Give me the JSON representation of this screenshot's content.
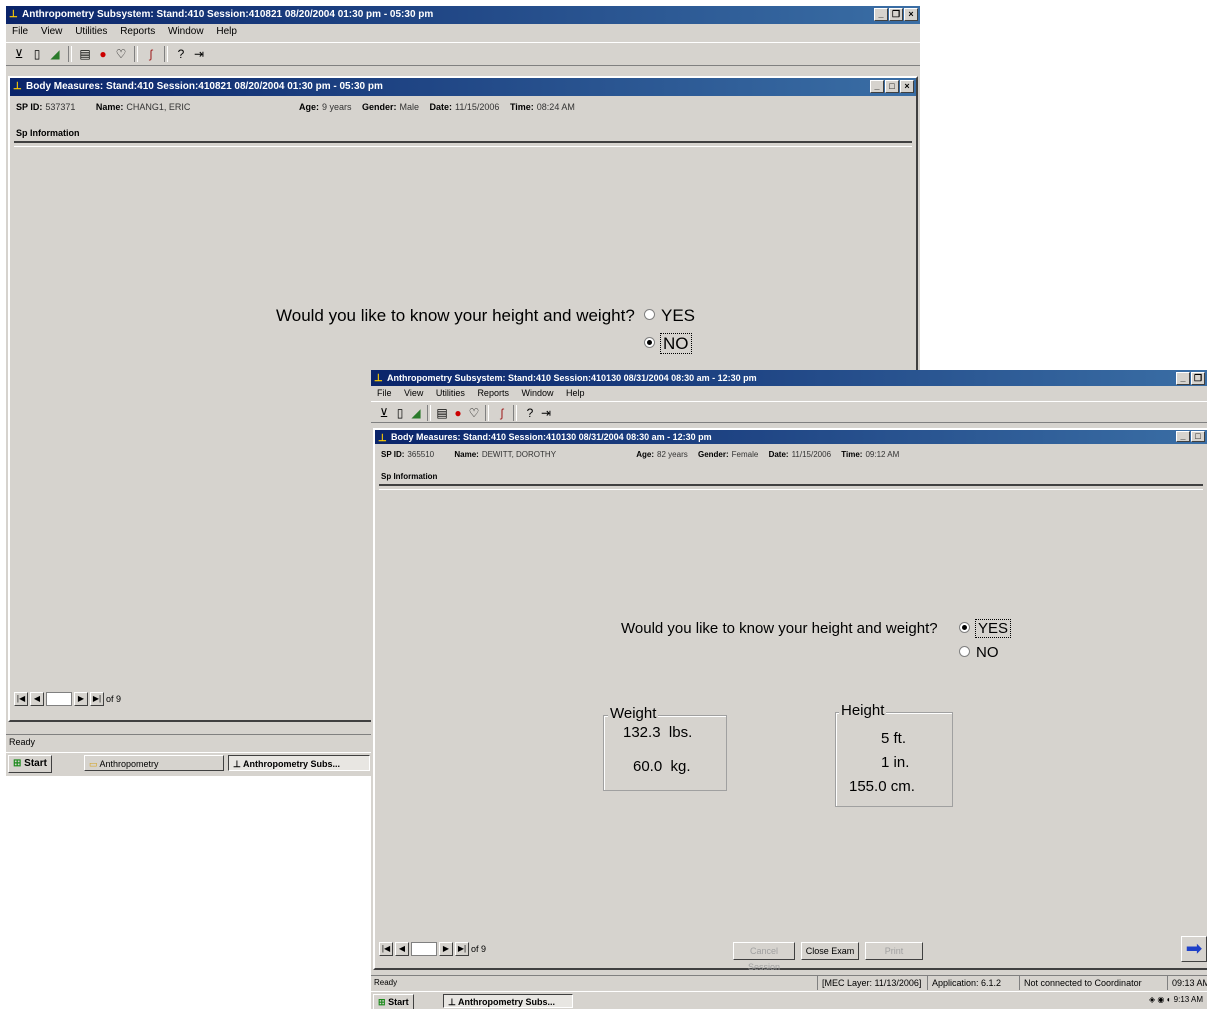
{
  "back": {
    "app_title": "Anthropometry Subsystem: Stand:410 Session:410821 08/20/2004 01:30 pm - 05:30 pm",
    "menu": [
      "File",
      "View",
      "Utilities",
      "Reports",
      "Window",
      "Help"
    ],
    "child_title": "Body Measures: Stand:410 Session:410821 08/20/2004 01:30 pm - 05:30 pm",
    "info": {
      "spid_label": "SP ID:",
      "spid": "537371",
      "name_label": "Name:",
      "name": "CHANG1, ERIC",
      "age_label": "Age:",
      "age": "9 years",
      "gender_label": "Gender:",
      "gender": "Male",
      "date_label": "Date:",
      "date": "11/15/2006",
      "time_label": "Time:",
      "time": "08:24 AM"
    },
    "section": "Sp Information",
    "question": "Would you like to know your height and weight?",
    "yes": "YES",
    "no": "NO",
    "selected": "NO",
    "nav_of": "of 9",
    "status": "Ready",
    "taskbar": {
      "start": "Start",
      "folder": "Anthropometry",
      "app": "Anthropometry Subs..."
    }
  },
  "front": {
    "app_title": "Anthropometry Subsystem: Stand:410 Session:410130 08/31/2004 08:30 am - 12:30 pm",
    "menu": [
      "File",
      "View",
      "Utilities",
      "Reports",
      "Window",
      "Help"
    ],
    "child_title": "Body Measures: Stand:410 Session:410130 08/31/2004 08:30 am - 12:30 pm",
    "info": {
      "spid_label": "SP ID:",
      "spid": "365510",
      "name_label": "Name:",
      "name": "DEWITT, DOROTHY",
      "age_label": "Age:",
      "age": "82 years",
      "gender_label": "Gender:",
      "gender": "Female",
      "date_label": "Date:",
      "date": "11/15/2006",
      "time_label": "Time:",
      "time": "09:12 AM"
    },
    "section": "Sp Information",
    "question": "Would you like to know your height and weight?",
    "yes": "YES",
    "no": "NO",
    "selected": "YES",
    "weight": {
      "title": "Weight",
      "lbs": "132.3",
      "lbs_unit": "lbs.",
      "kg": "60.0",
      "kg_unit": "kg."
    },
    "height": {
      "title": "Height",
      "ft": "5",
      "ft_unit": "ft.",
      "in": "1",
      "in_unit": "in.",
      "cm": "155.0",
      "cm_unit": "cm."
    },
    "nav_of": "of 9",
    "buttons": {
      "cancel": "Cancel Session",
      "close": "Close Exam",
      "print": "Print"
    },
    "status": {
      "ready": "Ready",
      "layer": "[MEC Layer: 11/13/2006]",
      "application": "Application: 6.1.2",
      "connection": "Not connected to Coordinator",
      "time": "09:13 AM"
    },
    "taskbar": {
      "start": "Start",
      "app": "Anthropometry Subs...",
      "clock": "9:13 AM"
    }
  },
  "colors": {
    "window_bg": "#d6d3ce",
    "title_start": "#0a246a",
    "title_end": "#3a6ea5",
    "next_arrow": "#1e40c8"
  },
  "icons": [
    "app-icon",
    "new-icon",
    "open-icon",
    "save-icon",
    "print-icon",
    "record-icon",
    "exam-icon",
    "tool-icon",
    "help-icon",
    "exit-icon",
    "next-arrow-icon"
  ]
}
